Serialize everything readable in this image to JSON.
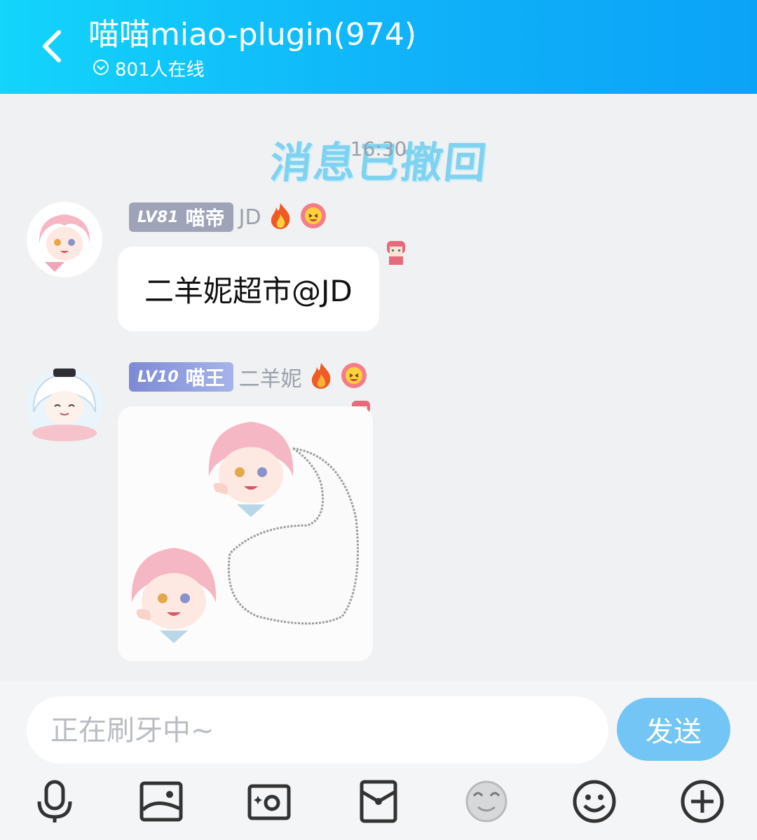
{
  "header": {
    "title": "喵喵miao-plugin(974)",
    "online": "801人在线"
  },
  "chat": {
    "timestamp": "16:30",
    "recall_banner": "消息已撤回",
    "messages": [
      {
        "level": "LV81",
        "title": "喵帝",
        "nickname": "JD",
        "text": "二羊妮超市@JD",
        "badge_color": "#9ea3b8"
      },
      {
        "level": "LV10",
        "title": "喵王",
        "nickname": "二羊妮",
        "badge_color": "#8a97d8"
      }
    ]
  },
  "input": {
    "placeholder": "正在刷牙中~",
    "send_label": "发送"
  },
  "toolbar": [
    "mic-icon",
    "image-icon",
    "camera-icon",
    "red-packet-icon",
    "sticker-icon",
    "emoji-icon",
    "plus-icon"
  ]
}
